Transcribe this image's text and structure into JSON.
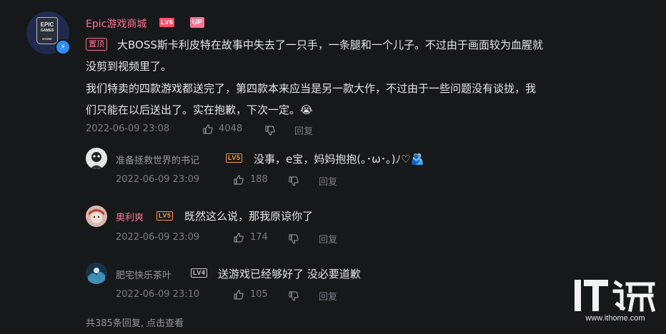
{
  "main_comment": {
    "avatar_text": [
      "EPIC",
      "GAMES",
      "STORE"
    ],
    "username": "Epic游戏商城",
    "level_badge": "LV6",
    "up_badge": "UP",
    "pin_label": "置顶",
    "lines": [
      "大BOSS斯卡利皮特在故事中失去了一只手，一条腿和一个儿子。不过由于画面较为血腥就",
      "没剪到视频里了。",
      "我们特卖的四款游戏都送完了，第四款本来应当是另一款大作，不过由于一些问题没有谈拢，我",
      "们只能在以后送出了。实在抱歉，下次一定。"
    ],
    "emoji": "😭",
    "timestamp": "2022-06-09 23:08",
    "likes": "4048",
    "reply_label": "回复"
  },
  "replies": [
    {
      "username": "准备拯救世界的书记",
      "level_badge": "LV5",
      "text": "没事，e宝，妈妈抱抱(｡･ω･｡)ﾉ♡🫂",
      "timestamp": "2022-06-09 23:09",
      "likes": "188",
      "reply_label": "回复"
    },
    {
      "username": "奥利爽",
      "level_badge": "LV5",
      "text": "既然这么说，那我原谅你了",
      "timestamp": "2022-06-09 23:09",
      "likes": "174",
      "reply_label": "回复"
    },
    {
      "username": "肥宅快乐茶叶",
      "level_badge": "LV4",
      "text": "送游戏已经够好了 没必要道歉",
      "timestamp": "2022-06-09 23:10",
      "likes": "105",
      "reply_label": "回复"
    }
  ],
  "footer": {
    "total_replies": "共385条回复, 点击查看"
  },
  "watermark": {
    "url": "www.ithome.com"
  },
  "colors": {
    "background": "#17181a",
    "up_name": "#fb7299",
    "level6": "#ff4d6a",
    "level5": "#ff9a3c",
    "meta": "#7a7d83"
  }
}
